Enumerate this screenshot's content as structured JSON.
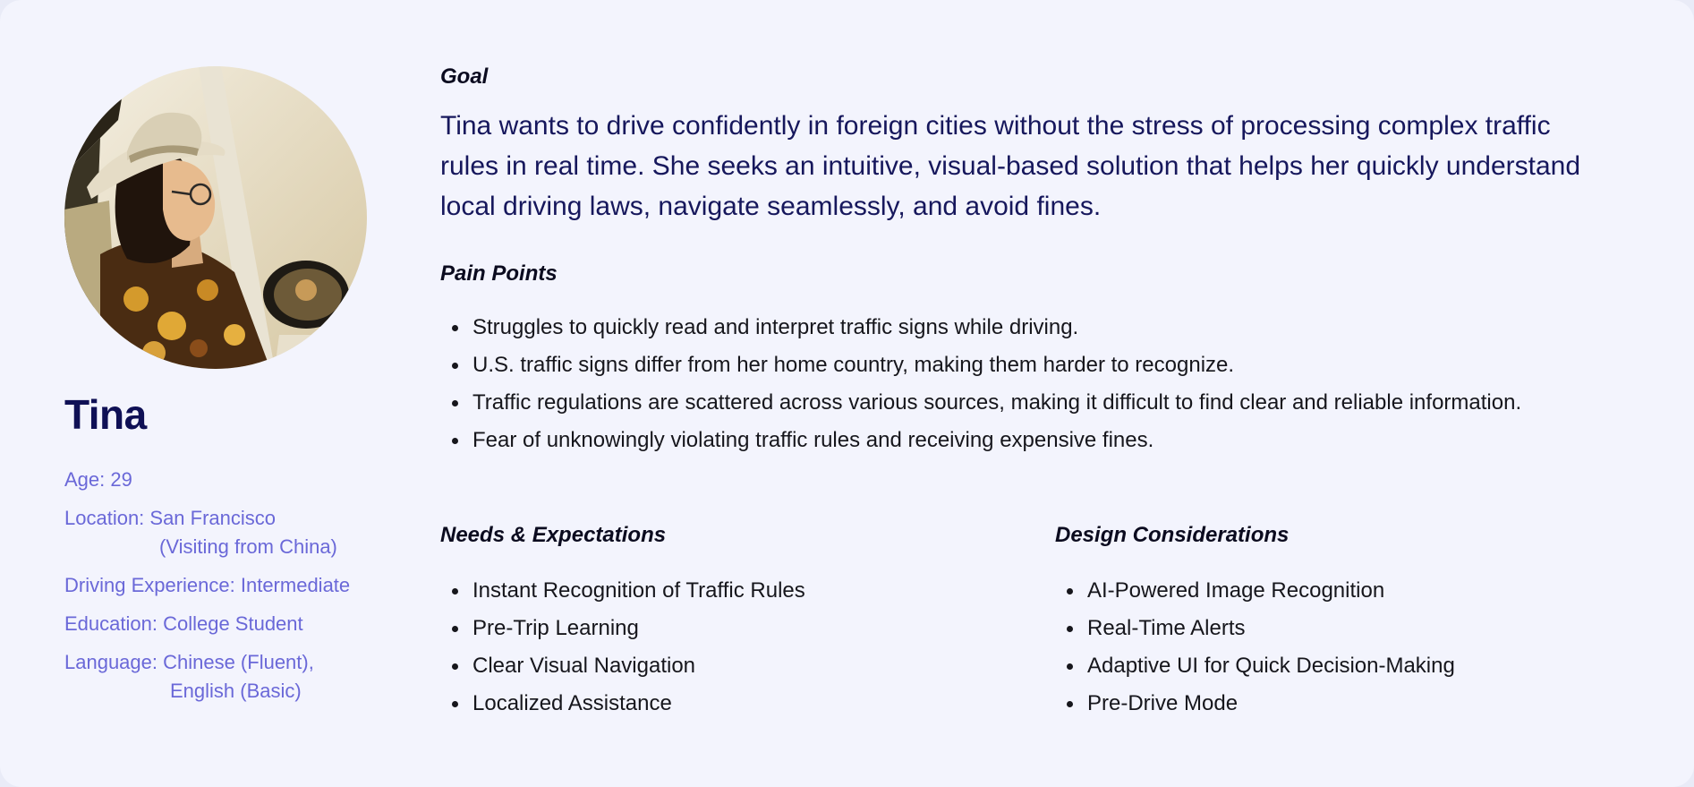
{
  "persona": {
    "name": "Tina",
    "attributes": {
      "age": "Age: 29",
      "location_line1": "Location: San Francisco",
      "location_line2": "(Visiting from China)",
      "driving_experience": "Driving Experience: Intermediate",
      "education": "Education: College Student",
      "language_line1": "Language: Chinese (Fluent),",
      "language_line2": "English (Basic)"
    }
  },
  "goal": {
    "heading": "Goal",
    "text": "Tina wants to drive confidently in foreign cities without the stress of processing complex traffic rules in real time. She seeks an intuitive, visual-based solution that helps her quickly understand local driving laws, navigate seamlessly, and avoid fines."
  },
  "pain_points": {
    "heading": "Pain Points",
    "items": [
      "Struggles to quickly read and interpret traffic signs while driving.",
      "U.S. traffic signs differ from her home country, making them harder to recognize.",
      "Traffic regulations are scattered across various sources, making it difficult to find clear and reliable information.",
      "Fear of unknowingly violating traffic rules and receiving expensive fines."
    ]
  },
  "needs": {
    "heading": "Needs & Expectations",
    "items": [
      "Instant Recognition of Traffic Rules",
      "Pre-Trip Learning",
      "Clear Visual Navigation",
      "Localized Assistance"
    ]
  },
  "design": {
    "heading": "Design Considerations",
    "items": [
      "AI-Powered Image Recognition",
      "Real-Time Alerts",
      "Adaptive UI for Quick Decision-Making",
      "Pre-Drive Mode"
    ]
  },
  "colors": {
    "card_background": "#f3f4fd",
    "name_color": "#0f1055",
    "attribute_color": "#6a68d8",
    "goal_text_color": "#16175c"
  }
}
